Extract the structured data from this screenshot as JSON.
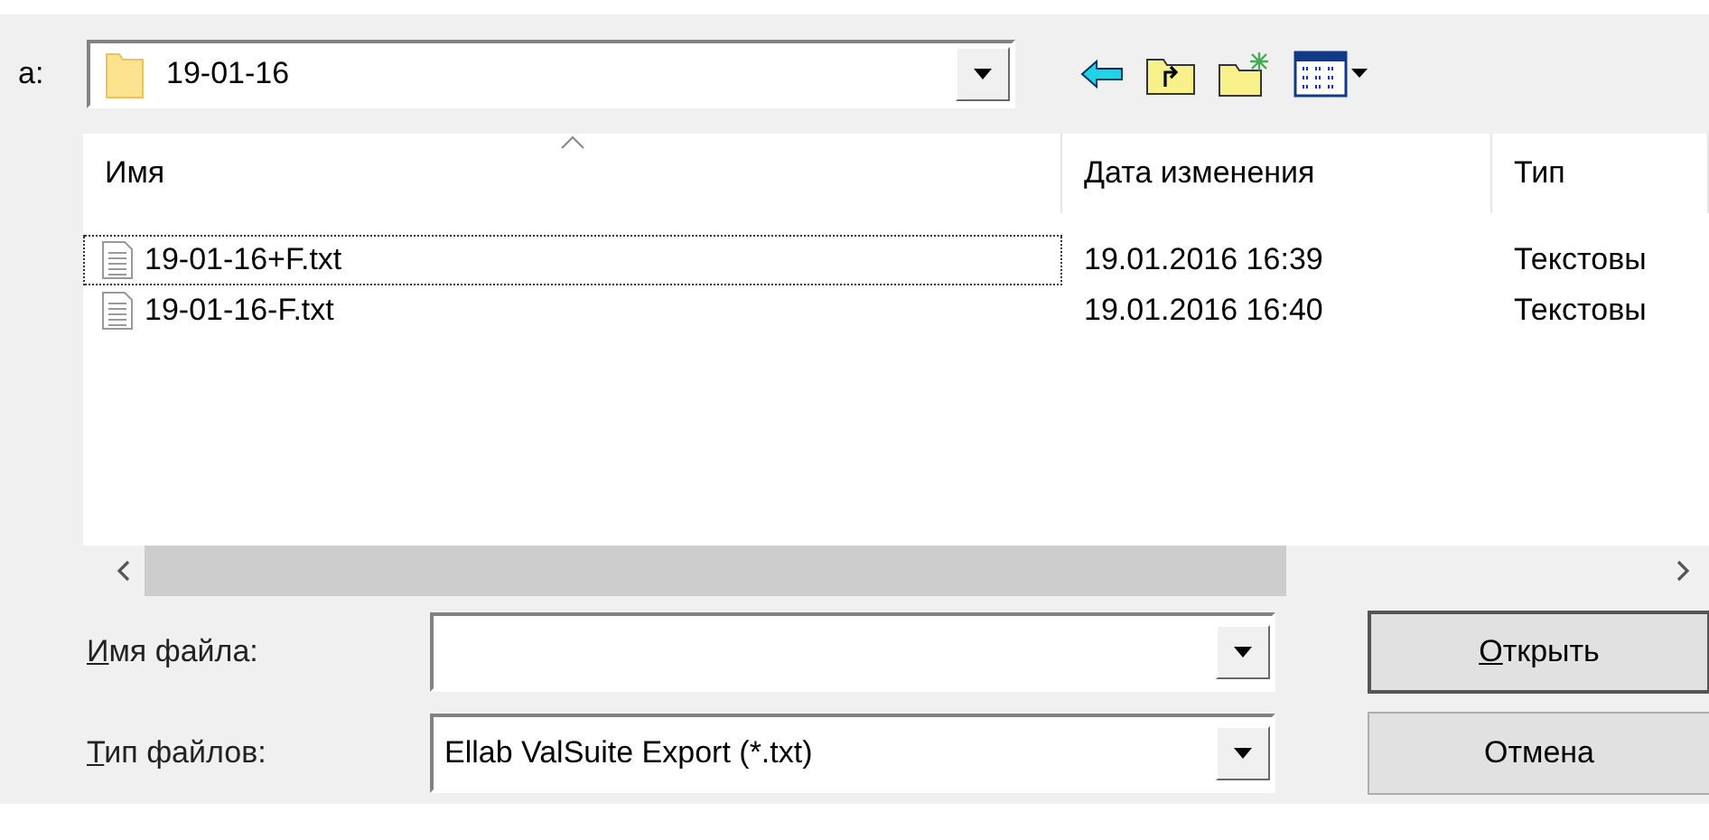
{
  "location": {
    "label": "а:",
    "folder": "19-01-16"
  },
  "toolbar": [
    {
      "kind": "back"
    },
    {
      "kind": "up"
    },
    {
      "kind": "new-folder"
    },
    {
      "kind": "view"
    }
  ],
  "file_list": {
    "columns": [
      {
        "label": "Имя",
        "sorted": true
      },
      {
        "label": "Дата изменения",
        "sorted": false
      },
      {
        "label": "Тип",
        "sorted": false
      }
    ],
    "rows": [
      {
        "name": "19-01-16+F.txt",
        "date": "19.01.2016 16:39",
        "type": "Текстовы",
        "focused": true
      },
      {
        "name": "19-01-16-F.txt",
        "date": "19.01.2016 16:40",
        "type": "Текстовы",
        "focused": false
      }
    ]
  },
  "fields": [
    {
      "label": "Имя файла:",
      "first_letter_underlined": true
    },
    {
      "label": "Тип файлов:",
      "first_letter_underlined": true,
      "value": "Ellab ValSuite Export (*.txt)"
    }
  ],
  "buttons": [
    {
      "label": "Открыть",
      "first_letter_underlined": true
    },
    {
      "label": "Отмена",
      "first_letter_underlined": false
    }
  ]
}
